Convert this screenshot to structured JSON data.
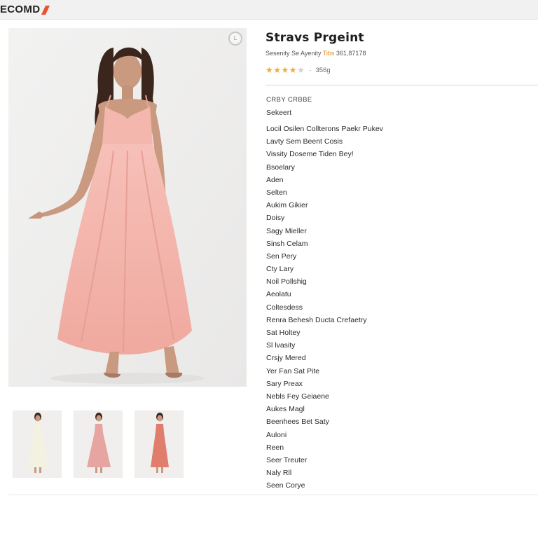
{
  "app": {
    "brand": "ECOMD"
  },
  "product": {
    "title": "Stravs Prgeint",
    "subtitle_prefix": "Sesenity Se Ayenity ",
    "subtitle_highlight": "Tibs",
    "subtitle_suffix": " 361,87178",
    "rating_stars": 4,
    "rating_max": 5,
    "rating_sep": "·",
    "rating_count": "356g"
  },
  "attributes": {
    "header": "CRBY CRBBE",
    "subheader": "Sekeert",
    "items": [
      "Locil Osilen Collterons Paekr Pukev",
      "Lavty Sem Beent Cosis",
      "Vissity Doseme Tiden Bey!",
      "Bsoelary",
      "Aden",
      "Selten",
      "Aukim Gikier",
      "Doisy",
      "Sagy Mieller",
      "Sinsh Celam",
      "Sen Pery",
      "Cty Lary",
      "Noil Pollshig",
      "Aeolatu",
      "Coltesdess",
      "Renra Behesh Ducta Crefaetry",
      "Sat Holtey",
      "Sl lvasity",
      "Crsjy Mered",
      "Yer Fan Sat Pite",
      "Sary Preax",
      "Nebls Fey Geiaene",
      "Aukes Magl",
      "Beenhees Bet Saty",
      "Auloni",
      "Reen",
      "Seer Treuter",
      "Naly Rll",
      "Seen Corye"
    ]
  },
  "colors": {
    "dress_main": "#f4b7ae",
    "thumb_dress_1": "#f3f1df",
    "thumb_dress_2": "#e6a5a0",
    "thumb_dress_3": "#e07d6c",
    "star": "#f2a93b",
    "brand_accent": "#e8542f"
  },
  "icons": {
    "zoom": "magnify-icon",
    "logo_mark": "slash-logo-icon"
  }
}
